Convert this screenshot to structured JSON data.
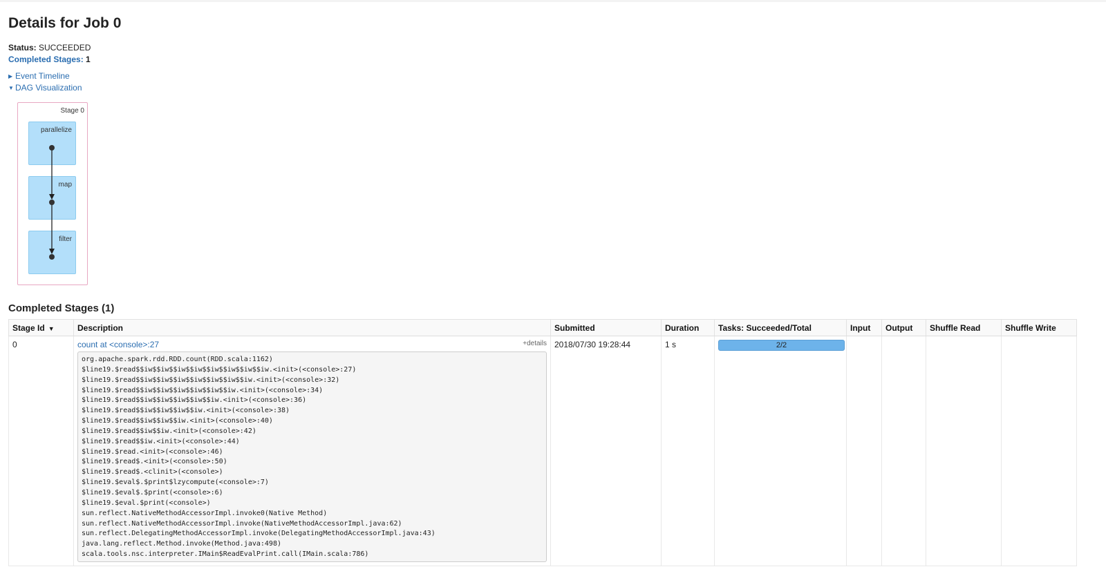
{
  "job": {
    "title": "Details for Job 0",
    "status_label": "Status:",
    "status_value": "SUCCEEDED",
    "completed_stages_label": "Completed Stages:",
    "completed_stages_value": "1"
  },
  "toggles": {
    "event_timeline": "Event Timeline",
    "dag_visualization": "DAG Visualization"
  },
  "dag": {
    "stage_label": "Stage 0",
    "nodes": [
      "parallelize",
      "map",
      "filter"
    ]
  },
  "stages_section": {
    "title": "Completed Stages (1)",
    "columns": [
      "Stage Id",
      "Description",
      "Submitted",
      "Duration",
      "Tasks: Succeeded/Total",
      "Input",
      "Output",
      "Shuffle Read",
      "Shuffle Write"
    ],
    "row": {
      "stage_id": "0",
      "description": "count at <console>:27",
      "details_link": "+details",
      "submitted": "2018/07/30 19:28:44",
      "duration": "1 s",
      "tasks": "2/2",
      "tasks_fraction": 1.0,
      "input": "",
      "output": "",
      "shuffle_read": "",
      "shuffle_write": "",
      "stack_trace": [
        "org.apache.spark.rdd.RDD.count(RDD.scala:1162)",
        "$line19.$read$$iw$$iw$$iw$$iw$$iw$$iw$$iw$$iw.<init>(<console>:27)",
        "$line19.$read$$iw$$iw$$iw$$iw$$iw$$iw$$iw.<init>(<console>:32)",
        "$line19.$read$$iw$$iw$$iw$$iw$$iw$$iw.<init>(<console>:34)",
        "$line19.$read$$iw$$iw$$iw$$iw$$iw.<init>(<console>:36)",
        "$line19.$read$$iw$$iw$$iw$$iw.<init>(<console>:38)",
        "$line19.$read$$iw$$iw$$iw.<init>(<console>:40)",
        "$line19.$read$$iw$$iw.<init>(<console>:42)",
        "$line19.$read$$iw.<init>(<console>:44)",
        "$line19.$read.<init>(<console>:46)",
        "$line19.$read$.<init>(<console>:50)",
        "$line19.$read$.<clinit>(<console>)",
        "$line19.$eval$.$print$lzycompute(<console>:7)",
        "$line19.$eval$.$print(<console>:6)",
        "$line19.$eval.$print(<console>)",
        "sun.reflect.NativeMethodAccessorImpl.invoke0(Native Method)",
        "sun.reflect.NativeMethodAccessorImpl.invoke(NativeMethodAccessorImpl.java:62)",
        "sun.reflect.DelegatingMethodAccessorImpl.invoke(DelegatingMethodAccessorImpl.java:43)",
        "java.lang.reflect.Method.invoke(Method.java:498)",
        "scala.tools.nsc.interpreter.IMain$ReadEvalPrint.call(IMain.scala:786)"
      ]
    }
  },
  "colors": {
    "link": "#2a6db0",
    "dag_node": "#b3dffa",
    "stage_border": "#e8a7c2",
    "progress": "#6db3ea"
  }
}
